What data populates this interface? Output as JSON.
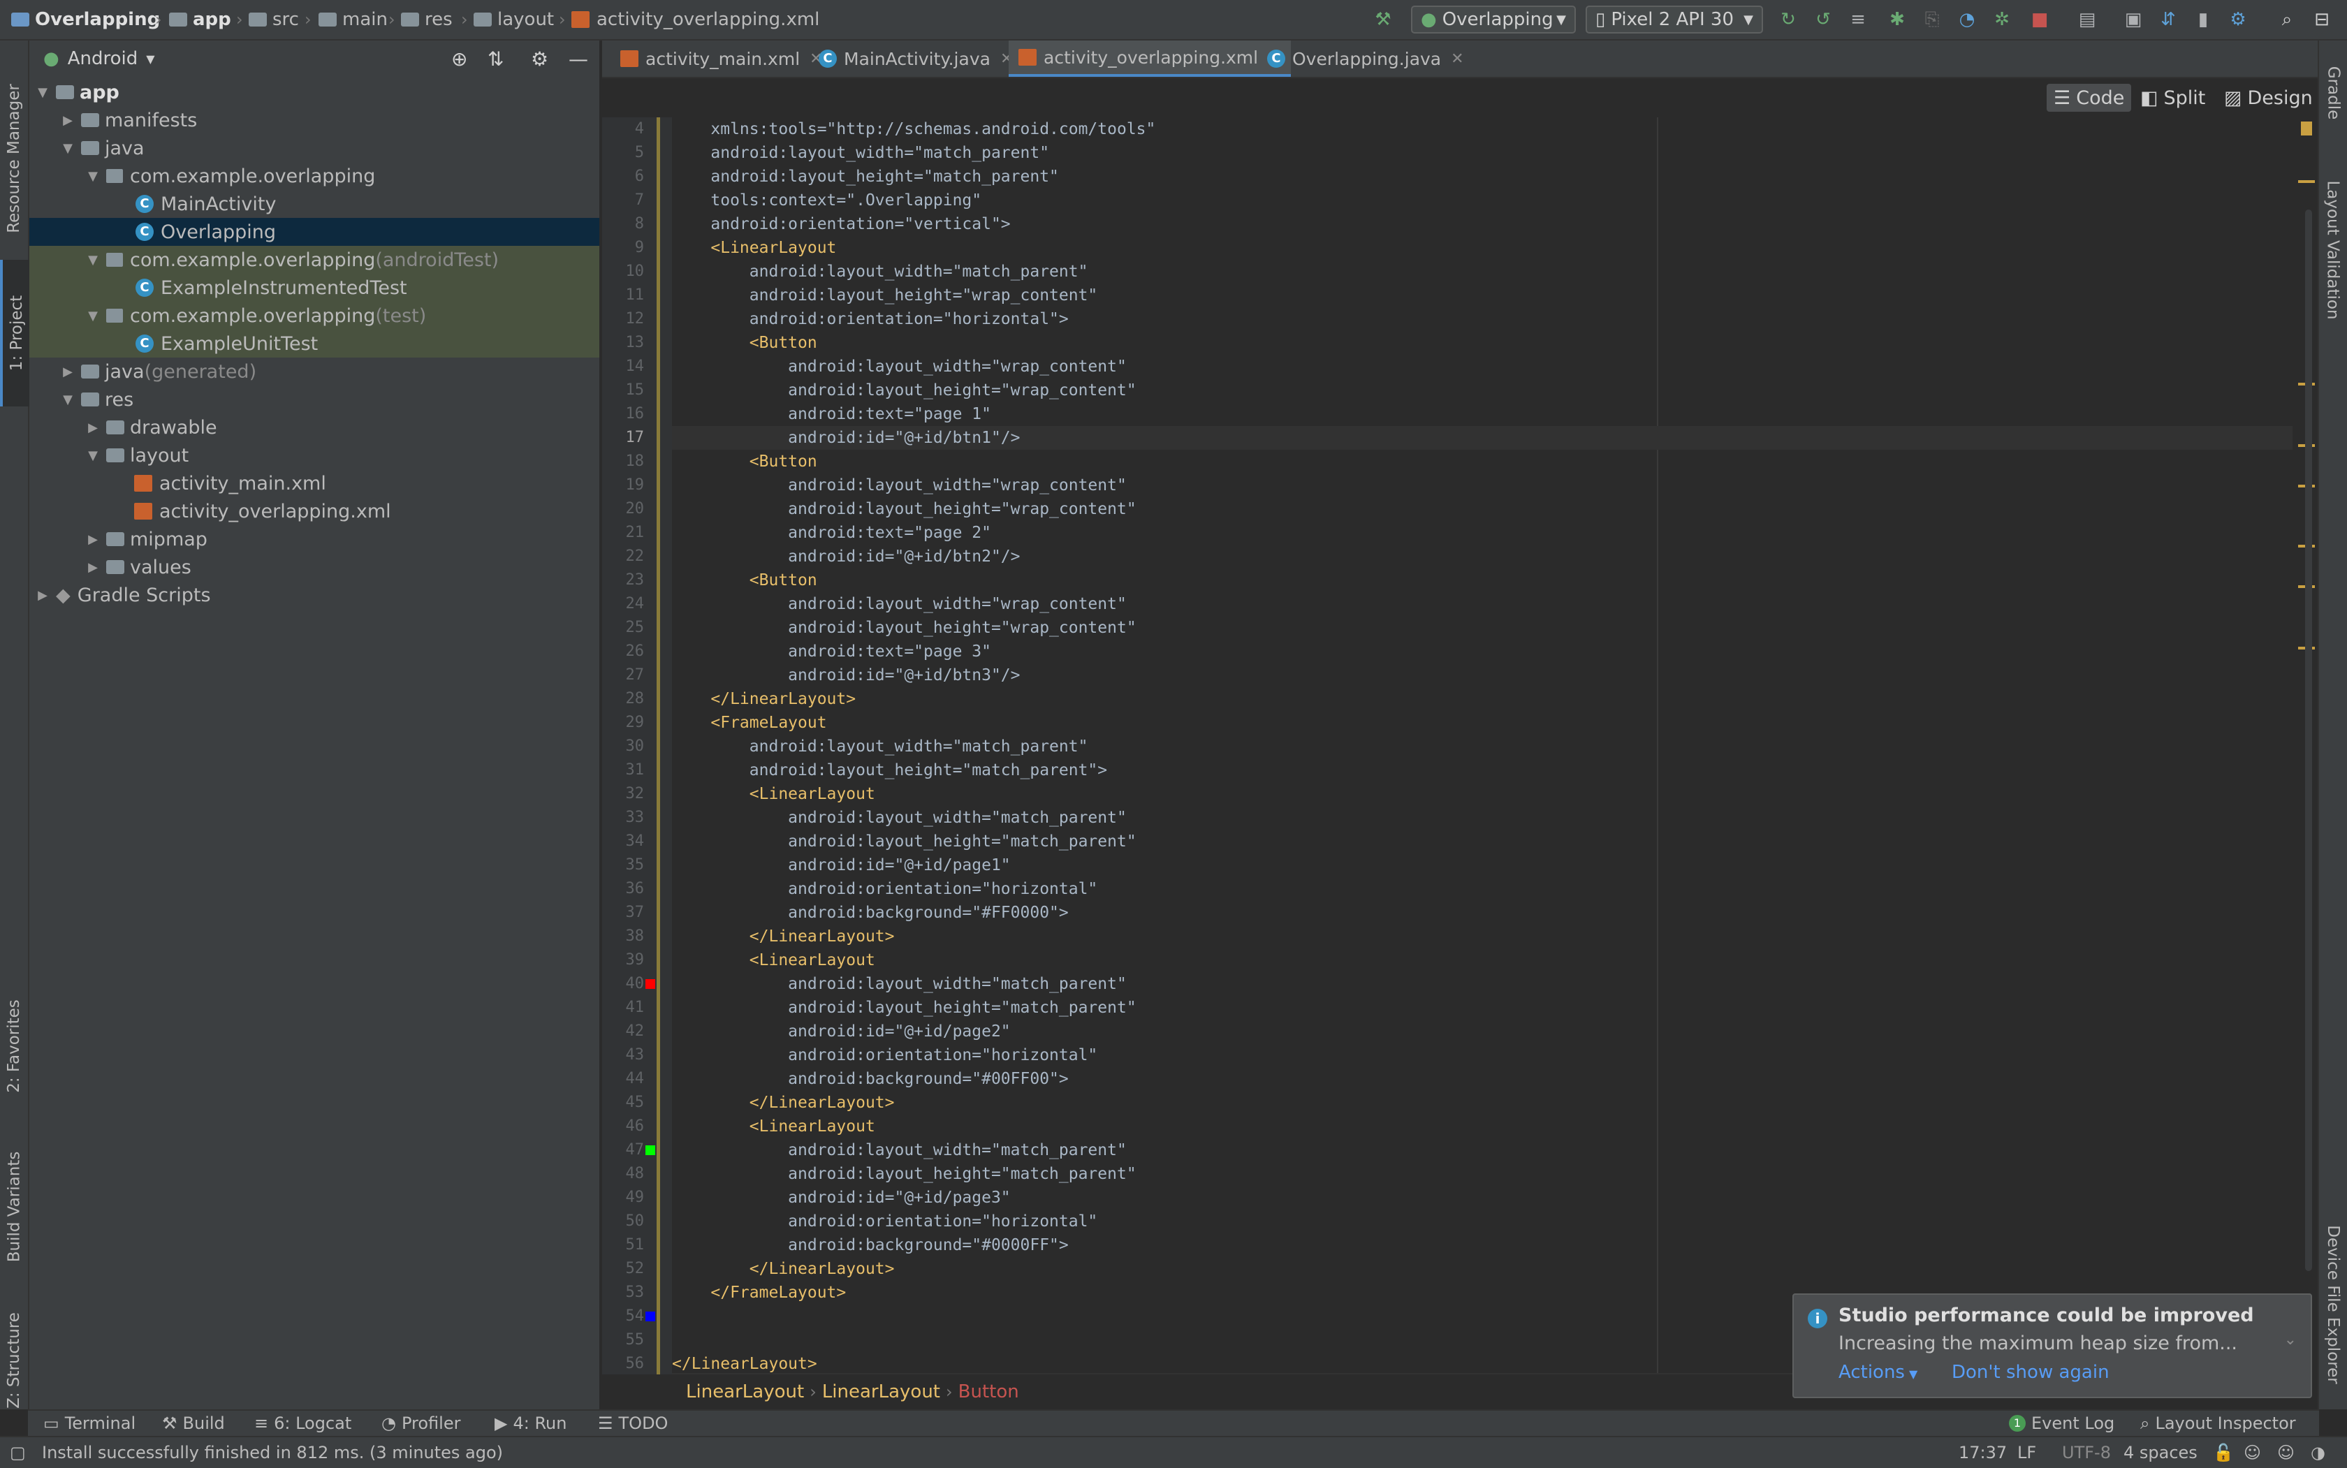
{
  "navbar": {
    "breadcrumb": [
      "Overlapping",
      "app",
      "src",
      "main",
      "res",
      "layout",
      "activity_overlapping.xml"
    ],
    "run_config": "Overlapping",
    "device": "Pixel 2 API 30"
  },
  "left_stripe": {
    "resource_manager": "Resource Manager",
    "project": "1: Project",
    "favorites": "2: Favorites",
    "build_variants": "Build Variants",
    "structure": "Z: Structure"
  },
  "right_stripe": {
    "gradle": "Gradle",
    "layout_validation": "Layout Validation",
    "device_file_explorer": "Device File Explorer"
  },
  "project_panel": {
    "view_selector": "Android",
    "tree": [
      {
        "label": "app",
        "suffix": ""
      },
      {
        "label": "manifests",
        "suffix": ""
      },
      {
        "label": "java",
        "suffix": ""
      },
      {
        "label": "com.example.overlapping",
        "suffix": ""
      },
      {
        "label": "MainActivity",
        "suffix": ""
      },
      {
        "label": "Overlapping",
        "suffix": ""
      },
      {
        "label": "com.example.overlapping",
        "suffix": " (androidTest)"
      },
      {
        "label": "ExampleInstrumentedTest",
        "suffix": ""
      },
      {
        "label": "com.example.overlapping",
        "suffix": " (test)"
      },
      {
        "label": "ExampleUnitTest",
        "suffix": ""
      },
      {
        "label": "java",
        "suffix": " (generated)"
      },
      {
        "label": "res",
        "suffix": ""
      },
      {
        "label": "drawable",
        "suffix": ""
      },
      {
        "label": "layout",
        "suffix": ""
      },
      {
        "label": "activity_main.xml",
        "suffix": ""
      },
      {
        "label": "activity_overlapping.xml",
        "suffix": ""
      },
      {
        "label": "mipmap",
        "suffix": ""
      },
      {
        "label": "values",
        "suffix": ""
      },
      {
        "label": "Gradle Scripts",
        "suffix": ""
      }
    ]
  },
  "editor": {
    "tabs": [
      "activity_main.xml",
      "MainActivity.java",
      "activity_overlapping.xml",
      "Overlapping.java"
    ],
    "active_tab": "activity_overlapping.xml",
    "modes": [
      "Code",
      "Split",
      "Design"
    ],
    "active_mode": "Code",
    "current_line": 17,
    "lines": [
      {
        "n": 4,
        "text": "    xmlns:tools=\"http://schemas.android.com/tools\""
      },
      {
        "n": 5,
        "text": "    android:layout_width=\"match_parent\""
      },
      {
        "n": 6,
        "text": "    android:layout_height=\"match_parent\""
      },
      {
        "n": 7,
        "text": "    tools:context=\".Overlapping\""
      },
      {
        "n": 8,
        "text": "    android:orientation=\"vertical\">"
      },
      {
        "n": 9,
        "text": "    <LinearLayout"
      },
      {
        "n": 10,
        "text": "        android:layout_width=\"match_parent\""
      },
      {
        "n": 11,
        "text": "        android:layout_height=\"wrap_content\""
      },
      {
        "n": 12,
        "text": "        android:orientation=\"horizontal\">"
      },
      {
        "n": 13,
        "text": "        <Button"
      },
      {
        "n": 14,
        "text": "            android:layout_width=\"wrap_content\""
      },
      {
        "n": 15,
        "text": "            android:layout_height=\"wrap_content\""
      },
      {
        "n": 16,
        "text": "            android:text=\"page 1\""
      },
      {
        "n": 17,
        "text": "            android:id=\"@+id/btn1\"/>"
      },
      {
        "n": 18,
        "text": "        <Button"
      },
      {
        "n": 19,
        "text": "            android:layout_width=\"wrap_content\""
      },
      {
        "n": 20,
        "text": "            android:layout_height=\"wrap_content\""
      },
      {
        "n": 21,
        "text": "            android:text=\"page 2\""
      },
      {
        "n": 22,
        "text": "            android:id=\"@+id/btn2\"/>"
      },
      {
        "n": 23,
        "text": "        <Button"
      },
      {
        "n": 24,
        "text": "            android:layout_width=\"wrap_content\""
      },
      {
        "n": 25,
        "text": "            android:layout_height=\"wrap_content\""
      },
      {
        "n": 26,
        "text": "            android:text=\"page 3\""
      },
      {
        "n": 27,
        "text": "            android:id=\"@+id/btn3\"/>"
      },
      {
        "n": 28,
        "text": "    </LinearLayout>"
      },
      {
        "n": 29,
        "text": "    <FrameLayout"
      },
      {
        "n": 30,
        "text": "        android:layout_width=\"match_parent\""
      },
      {
        "n": 31,
        "text": "        android:layout_height=\"match_parent\">"
      },
      {
        "n": 32,
        "text": "        <LinearLayout"
      },
      {
        "n": 33,
        "text": "            android:layout_width=\"match_parent\""
      },
      {
        "n": 34,
        "text": "            android:layout_height=\"match_parent\""
      },
      {
        "n": 35,
        "text": "            android:id=\"@+id/page1\""
      },
      {
        "n": 36,
        "text": "            android:orientation=\"horizontal\""
      },
      {
        "n": 37,
        "text": "            android:background=\"#FF0000\">"
      },
      {
        "n": 38,
        "text": "        </LinearLayout>"
      },
      {
        "n": 39,
        "text": "        <LinearLayout"
      },
      {
        "n": 40,
        "text": "            android:layout_width=\"match_parent\""
      },
      {
        "n": 41,
        "text": "            android:layout_height=\"match_parent\""
      },
      {
        "n": 42,
        "text": "            android:id=\"@+id/page2\""
      },
      {
        "n": 43,
        "text": "            android:orientation=\"horizontal\""
      },
      {
        "n": 44,
        "text": "            android:background=\"#00FF00\">"
      },
      {
        "n": 45,
        "text": "        </LinearLayout>"
      },
      {
        "n": 46,
        "text": "        <LinearLayout"
      },
      {
        "n": 47,
        "text": "            android:layout_width=\"match_parent\""
      },
      {
        "n": 48,
        "text": "            android:layout_height=\"match_parent\""
      },
      {
        "n": 49,
        "text": "            android:id=\"@+id/page3\""
      },
      {
        "n": 50,
        "text": "            android:orientation=\"horizontal\""
      },
      {
        "n": 51,
        "text": "            android:background=\"#0000FF\">"
      },
      {
        "n": 52,
        "text": "        </LinearLayout>"
      },
      {
        "n": 53,
        "text": "    </FrameLayout>"
      },
      {
        "n": 54,
        "text": ""
      },
      {
        "n": 55,
        "text": ""
      },
      {
        "n": 56,
        "text": "</LinearLayout>"
      }
    ],
    "gutter_swatches": [
      {
        "line": 37,
        "color": "#FF0000"
      },
      {
        "line": 44,
        "color": "#00FF00"
      },
      {
        "line": 51,
        "color": "#0000FF"
      }
    ],
    "breadcrumb": [
      "LinearLayout",
      "LinearLayout",
      "Button"
    ]
  },
  "notification": {
    "title": "Studio performance could be improved",
    "body": "Increasing the maximum heap size from...",
    "actions_label": "Actions",
    "dismiss_label": "Don't show again"
  },
  "bottom_tools": {
    "terminal": "Terminal",
    "build": "Build",
    "logcat": "6: Logcat",
    "profiler": "Profiler",
    "run": "4: Run",
    "todo": "TODO",
    "event_log": "Event Log",
    "event_log_count": "1",
    "layout_inspector": "Layout Inspector"
  },
  "status": {
    "message": "Install successfully finished in 812 ms. (3 minutes ago)",
    "position": "17:37",
    "line_sep": "LF",
    "encoding": "UTF-8",
    "indent": "4 spaces"
  },
  "colors": {
    "accent": "#4a88c7",
    "selection": "#0d293e",
    "test_bg": "#49523f"
  }
}
